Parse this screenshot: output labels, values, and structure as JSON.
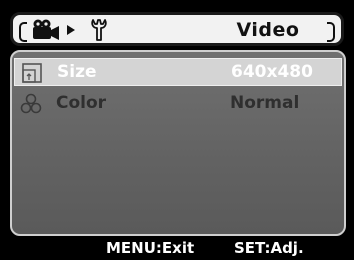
{
  "header": {
    "title": "Video",
    "icons": [
      "video-camera-icon",
      "play-arrow-icon",
      "wrench-icon"
    ]
  },
  "menu": {
    "items": [
      {
        "label": "Size",
        "value": "640x480",
        "icon": "size-icon",
        "selected": true
      },
      {
        "label": "Color",
        "value": "Normal",
        "icon": "color-palette-icon",
        "selected": false
      }
    ]
  },
  "footer": {
    "menu_hint": "MENU:Exit",
    "set_hint": "SET:Adj."
  },
  "colors": {
    "header_bg": "#f2f2f2",
    "panel_bg": "#666666",
    "selected_row_bg": "#d4d4d4",
    "text_light": "#ffffff",
    "text_dim": "#2f2f2f"
  }
}
